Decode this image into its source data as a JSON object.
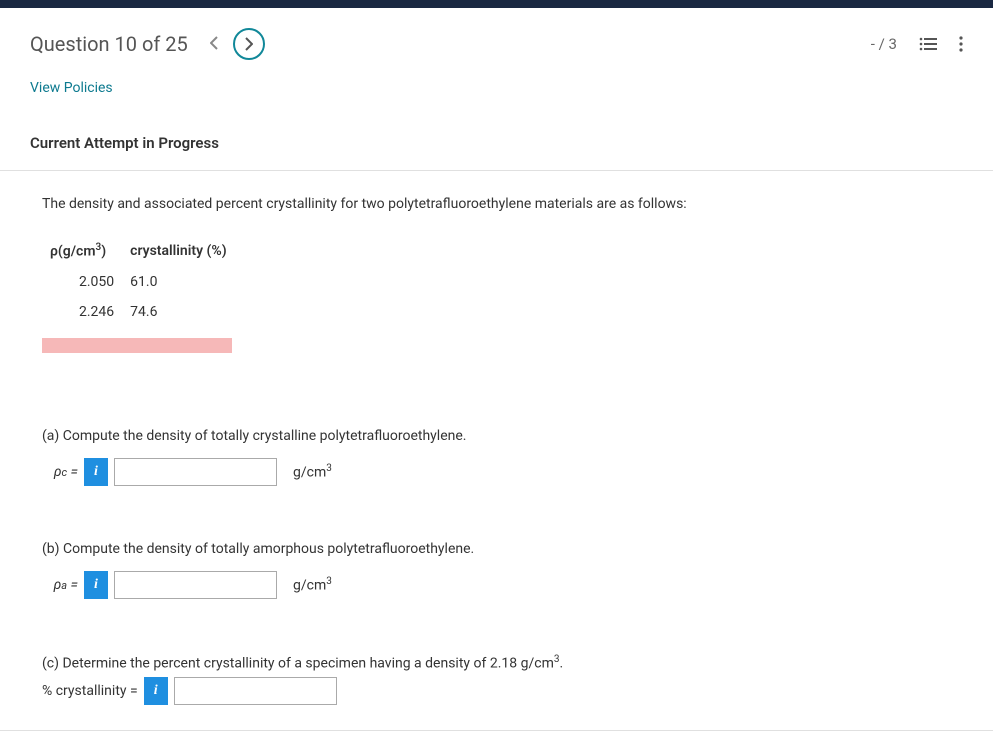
{
  "header": {
    "question_title": "Question 10 of 25",
    "score": "- / 3"
  },
  "view_policies": "View Policies",
  "section_title": "Current Attempt in Progress",
  "intro": "The density and associated percent crystallinity for two polytetrafluoroethylene materials are as follows:",
  "table": {
    "headers": {
      "rho_prefix": "ρ(g/cm",
      "sup": "3",
      "rho_suffix": ")",
      "crystallinity": "crystallinity (%)"
    },
    "rows": [
      {
        "density": "2.050",
        "crystallinity": "61.0"
      },
      {
        "density": "2.246",
        "crystallinity": "74.6"
      }
    ]
  },
  "parts": {
    "a": {
      "text": "(a) Compute the density of totally crystalline polytetrafluoroethylene.",
      "label_prefix": "ρ",
      "label_sub": "c",
      "label_eq": " =",
      "unit_prefix": "g/cm",
      "unit_sup": "3"
    },
    "b": {
      "text": "(b) Compute the density of totally amorphous polytetrafluoroethylene.",
      "label_prefix": "ρ",
      "label_sub": "a",
      "label_eq": " =",
      "unit_prefix": "g/cm",
      "unit_sup": "3"
    },
    "c": {
      "text_prefix": "(c) Determine the percent crystallinity of a specimen having a density of 2.18 g/cm",
      "text_sup": "3",
      "text_suffix": ".",
      "label": "% crystallinity ="
    }
  },
  "info_icon": "i"
}
